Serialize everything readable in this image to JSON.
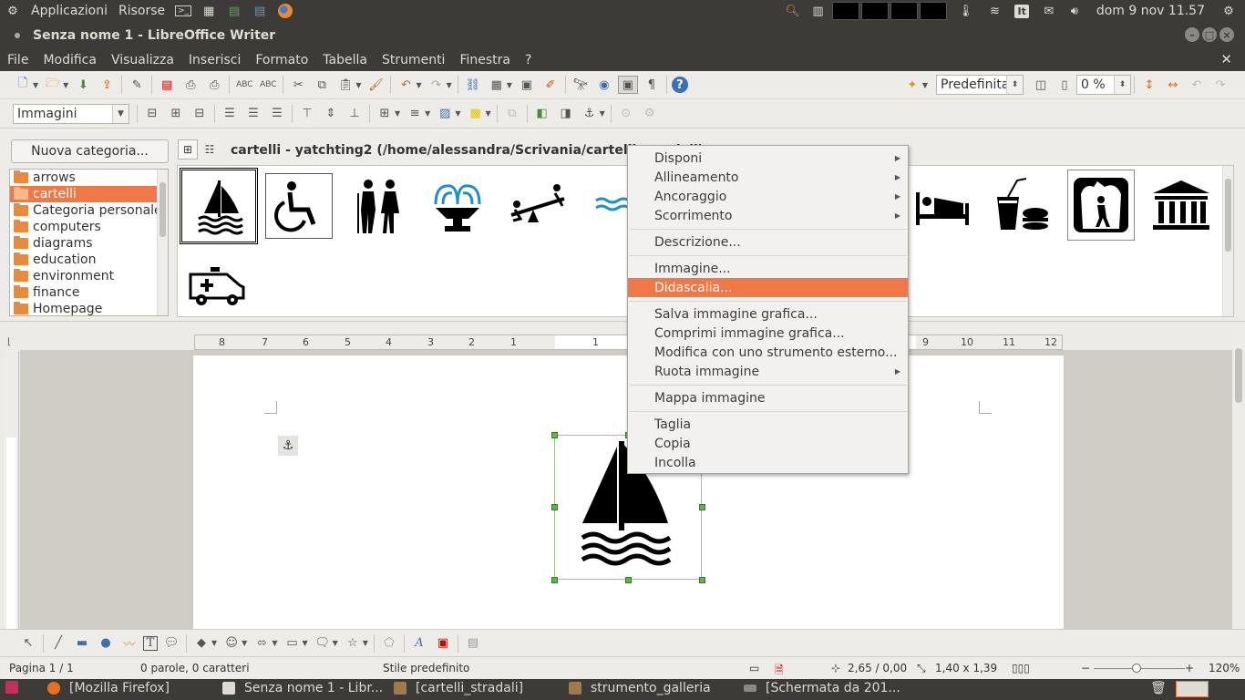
{
  "top_panel": {
    "applications": "Applicazioni",
    "places": "Risorse",
    "keyboard_layout": "It",
    "clock": "dom  9 nov 11.57"
  },
  "window": {
    "title": "Senza nome 1 - LibreOffice Writer"
  },
  "menubar": {
    "items": [
      "File",
      "Modifica",
      "Visualizza",
      "Inserisci",
      "Formato",
      "Tabella",
      "Strumenti",
      "Finestra",
      "?"
    ],
    "close_label": "✕"
  },
  "toolbar": {
    "zoom_value": "0 %",
    "preset_value": "Predefinita"
  },
  "formatting": {
    "frame_style": "Immagini"
  },
  "gallery": {
    "new_category_button": "Nuova categoria...",
    "title": "cartelli - yatchting2 (/home/alessandra/Scrivania/cartelli_stradali)",
    "categories": [
      {
        "label": "arrows",
        "selected": false
      },
      {
        "label": "cartelli",
        "selected": true
      },
      {
        "label": "Categoria personale",
        "selected": false
      },
      {
        "label": "computers",
        "selected": false
      },
      {
        "label": "diagrams",
        "selected": false
      },
      {
        "label": "education",
        "selected": false
      },
      {
        "label": "environment",
        "selected": false
      },
      {
        "label": "finance",
        "selected": false
      },
      {
        "label": "Homepage",
        "selected": false
      }
    ],
    "items": [
      "sailing-icon",
      "wheelchair-icon",
      "hikers-icon",
      "fountain-icon",
      "seesaw-icon",
      "waves-icon",
      "bed-icon",
      "fastfood-icon",
      "cave-icon",
      "museum-icon",
      "ambulance-icon"
    ]
  },
  "ruler": {
    "left_numbers": [
      "8",
      "7",
      "6",
      "5",
      "4",
      "3",
      "2",
      "1"
    ],
    "right_numbers": [
      "1",
      "9",
      "10",
      "11",
      "12"
    ]
  },
  "context_menu": {
    "items": [
      {
        "label": "Disponi",
        "submenu": true
      },
      {
        "label": "Allineamento",
        "submenu": true
      },
      {
        "label": "Ancoraggio",
        "submenu": true
      },
      {
        "label": "Scorrimento",
        "submenu": true
      },
      {
        "label": "Descrizione...",
        "submenu": false
      },
      {
        "label": "Immagine...",
        "submenu": false
      },
      {
        "label": "Didascalia...",
        "submenu": false,
        "highlighted": true
      },
      {
        "label": "Salva immagine grafica...",
        "submenu": false
      },
      {
        "label": "Comprimi immagine grafica...",
        "submenu": false
      },
      {
        "label": "Modifica con uno strumento esterno...",
        "submenu": false
      },
      {
        "label": "Ruota immagine",
        "submenu": true
      },
      {
        "label": "Mappa immagine",
        "submenu": false
      },
      {
        "label": "Taglia",
        "submenu": false
      },
      {
        "label": "Copia",
        "submenu": false
      },
      {
        "label": "Incolla",
        "submenu": false
      }
    ]
  },
  "statusbar": {
    "page": "Pagina 1 / 1",
    "words": "0 parole, 0 caratteri",
    "style": "Stile predefinito",
    "position": "2,65 / 0,00",
    "size": "1,40 x 1,39",
    "zoom": "120%"
  },
  "taskbar": {
    "items": [
      "[Mozilla Firefox]",
      "Senza nome 1 - Libr...",
      "[cartelli_stradali]",
      "strumento_galleria",
      "[Schermata da 201..."
    ]
  },
  "colors": {
    "accent": "#f07746",
    "panel": "#3c3b37"
  }
}
